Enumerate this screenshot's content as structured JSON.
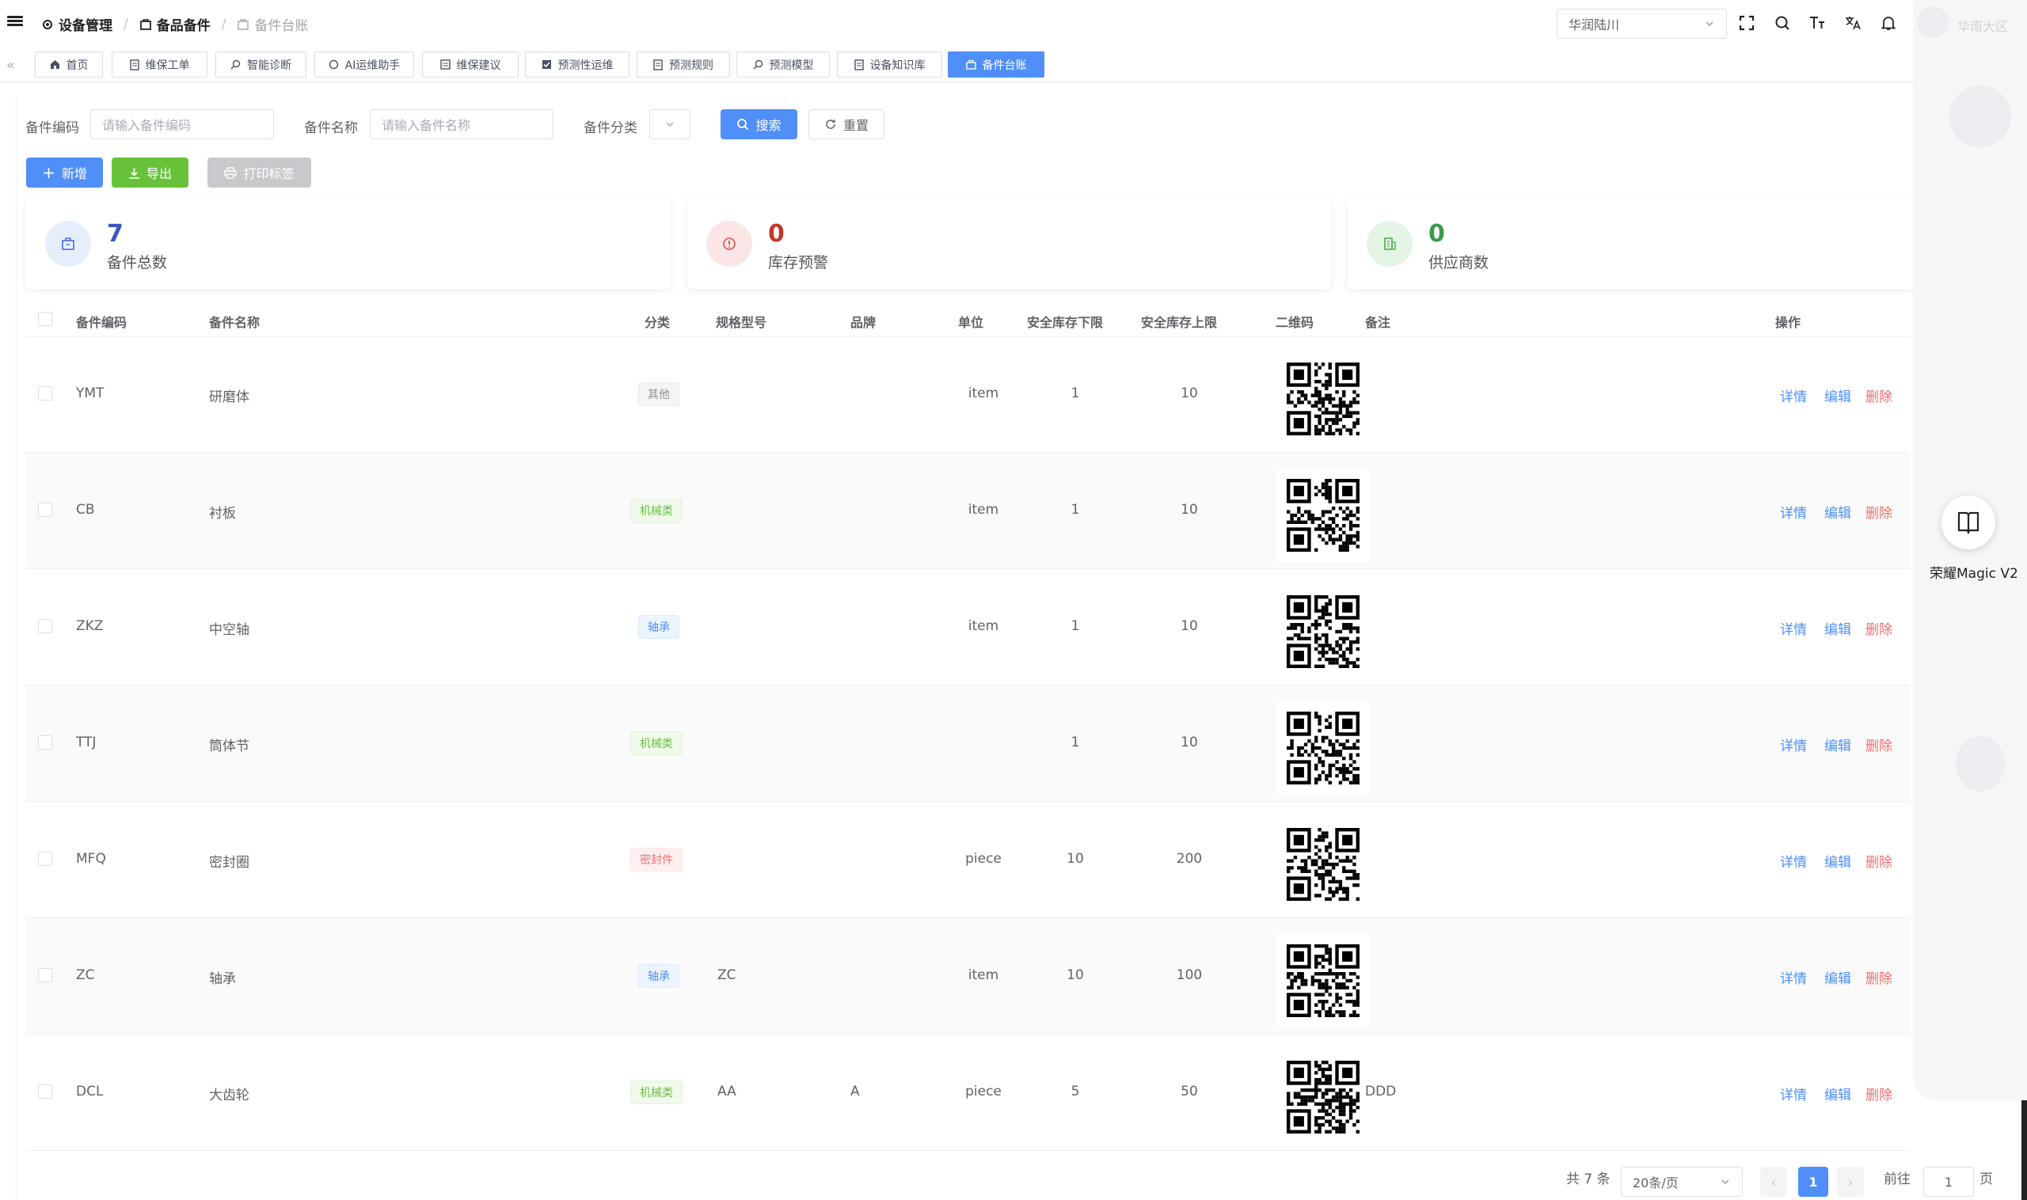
{
  "header": {
    "breadcrumb": [
      {
        "label": "设备管理",
        "icon": "gear-icon"
      },
      {
        "label": "备品备件",
        "icon": "box-icon"
      },
      {
        "label": "备件台账",
        "icon": "box-icon"
      }
    ],
    "region_select": "华润陆川",
    "user_name": "华南大区"
  },
  "tabs": [
    {
      "label": "首页",
      "icon": "home-icon",
      "active": false
    },
    {
      "label": "维保工单",
      "icon": "doc-icon",
      "active": false
    },
    {
      "label": "智能诊断",
      "icon": "search-icon",
      "active": false
    },
    {
      "label": "AI运维助手",
      "icon": "circle-icon",
      "active": false
    },
    {
      "label": "维保建议",
      "icon": "list-icon",
      "active": false
    },
    {
      "label": "预测性运维",
      "icon": "check-icon",
      "active": false
    },
    {
      "label": "预测规则",
      "icon": "doc-icon",
      "active": false
    },
    {
      "label": "预测模型",
      "icon": "search-icon",
      "active": false
    },
    {
      "label": "设备知识库",
      "icon": "doc-icon",
      "active": false
    },
    {
      "label": "备件台账",
      "icon": "box-icon",
      "active": true
    }
  ],
  "filters": {
    "code_label": "备件编码",
    "code_placeholder": "请输入备件编码",
    "name_label": "备件名称",
    "name_placeholder": "请输入备件名称",
    "category_label": "备件分类",
    "search_label": "搜索",
    "reset_label": "重置"
  },
  "toolbar": {
    "add_label": "新增",
    "export_label": "导出",
    "print_label": "打印标签"
  },
  "stats": [
    {
      "value": "7",
      "label": "备件总数",
      "color": "#3a56c4",
      "bg": "#e7eefb",
      "icon": "box-icon"
    },
    {
      "value": "0",
      "label": "库存预警",
      "color": "#c0392b",
      "bg": "#fbe5e5",
      "icon": "alert-icon"
    },
    {
      "value": "0",
      "label": "供应商数",
      "color": "#3a9a4a",
      "bg": "#e4f5e6",
      "icon": "building-icon"
    }
  ],
  "table": {
    "headers": {
      "code": "备件编码",
      "name": "备件名称",
      "category": "分类",
      "spec": "规格型号",
      "brand": "品牌",
      "unit": "单位",
      "min": "安全库存下限",
      "max": "安全库存上限",
      "qr": "二维码",
      "remark": "备注",
      "ops": "操作"
    },
    "rows": [
      {
        "code": "YMT",
        "name": "研磨体",
        "category": "其他",
        "cat_style": "gray",
        "spec": "",
        "brand": "",
        "unit": "item",
        "min": "1",
        "max": "10",
        "remark": ""
      },
      {
        "code": "CB",
        "name": "衬板",
        "category": "机械类",
        "cat_style": "green",
        "spec": "",
        "brand": "",
        "unit": "item",
        "min": "1",
        "max": "10",
        "remark": ""
      },
      {
        "code": "ZKZ",
        "name": "中空轴",
        "category": "轴承",
        "cat_style": "blue",
        "spec": "",
        "brand": "",
        "unit": "item",
        "min": "1",
        "max": "10",
        "remark": ""
      },
      {
        "code": "TTJ",
        "name": "筒体节",
        "category": "机械类",
        "cat_style": "green",
        "spec": "",
        "brand": "",
        "unit": "",
        "min": "1",
        "max": "10",
        "remark": ""
      },
      {
        "code": "MFQ",
        "name": "密封圈",
        "category": "密封件",
        "cat_style": "red",
        "spec": "",
        "brand": "",
        "unit": "piece",
        "min": "10",
        "max": "200",
        "remark": ""
      },
      {
        "code": "ZC",
        "name": "轴承",
        "category": "轴承",
        "cat_style": "blue",
        "spec": "ZC",
        "brand": "",
        "unit": "item",
        "min": "10",
        "max": "100",
        "remark": ""
      },
      {
        "code": "DCL",
        "name": "大齿轮",
        "category": "机械类",
        "cat_style": "green",
        "spec": "AA",
        "brand": "A",
        "unit": "piece",
        "min": "5",
        "max": "50",
        "remark": "DDD"
      }
    ],
    "actions": {
      "detail": "详情",
      "edit": "编辑",
      "delete": "删除"
    }
  },
  "pagination": {
    "total": "共 7 条",
    "page_size": "20条/页",
    "current_page": "1",
    "goto_label": "前往",
    "goto_value": "1",
    "page_suffix": "页"
  },
  "float_widget": {
    "label": "荣耀Magic V2"
  },
  "colors": {
    "primary": "#4f8ff7",
    "success": "#67c23a",
    "danger": "#f56c6c"
  }
}
